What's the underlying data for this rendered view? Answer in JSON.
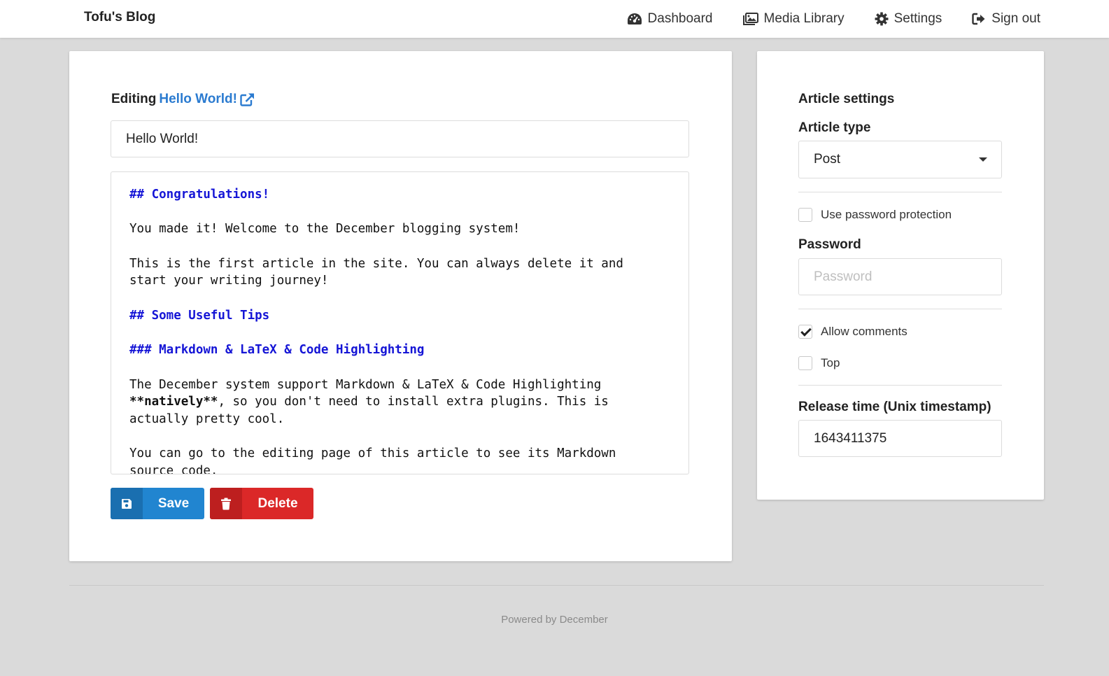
{
  "header": {
    "brand": "Tofu's Blog",
    "nav": [
      {
        "label": "Dashboard",
        "icon": "dashboard-gauge-icon"
      },
      {
        "label": "Media Library",
        "icon": "images-icon"
      },
      {
        "label": "Settings",
        "icon": "gear-icon"
      },
      {
        "label": "Sign out",
        "icon": "sign-out-icon"
      }
    ]
  },
  "editor": {
    "editing_prefix": "Editing",
    "article_link": "Hello World!",
    "title_value": "Hello World!",
    "content_lines": [
      {
        "text": "## Congratulations!",
        "type": "heading"
      },
      {
        "text": "",
        "type": "text"
      },
      {
        "text": "You made it! Welcome to the December blogging system!",
        "type": "text"
      },
      {
        "text": "",
        "type": "text"
      },
      {
        "text": "This is the first article in the site. You can always delete it and",
        "type": "text"
      },
      {
        "text": "start your writing journey!",
        "type": "text"
      },
      {
        "text": "",
        "type": "text"
      },
      {
        "text": "## Some Useful Tips",
        "type": "heading"
      },
      {
        "text": "",
        "type": "text"
      },
      {
        "text": "### Markdown & LaTeX & Code Highlighting",
        "type": "heading"
      },
      {
        "text": "",
        "type": "text"
      },
      {
        "text": "The December system support Markdown & LaTeX & Code Highlighting",
        "type": "text"
      },
      {
        "text": "**natively**, so you don't need to install extra plugins. This is",
        "type": "bold-start",
        "bold": "**natively**",
        "rest": ", so you don't need to install extra plugins. This is"
      },
      {
        "text": "actually pretty cool.",
        "type": "text"
      },
      {
        "text": "",
        "type": "text"
      },
      {
        "text": "You can go to the editing page of this article to see its Markdown",
        "type": "text"
      },
      {
        "text": "source code.",
        "type": "text"
      }
    ],
    "save_label": "Save",
    "delete_label": "Delete"
  },
  "settings": {
    "heading": "Article settings",
    "article_type_label": "Article type",
    "article_type_value": "Post",
    "password_protection_label": "Use password protection",
    "password_protection_checked": false,
    "password_label": "Password",
    "password_placeholder": "Password",
    "allow_comments_label": "Allow comments",
    "allow_comments_checked": true,
    "top_label": "Top",
    "top_checked": false,
    "release_time_label": "Release time (Unix timestamp)",
    "release_time_value": "1643411375"
  },
  "footer": {
    "text": "Powered by December"
  },
  "colors": {
    "link": "#2b7bd0",
    "save": "#2185d0",
    "delete": "#db2828",
    "heading_code": "#1515d6"
  }
}
